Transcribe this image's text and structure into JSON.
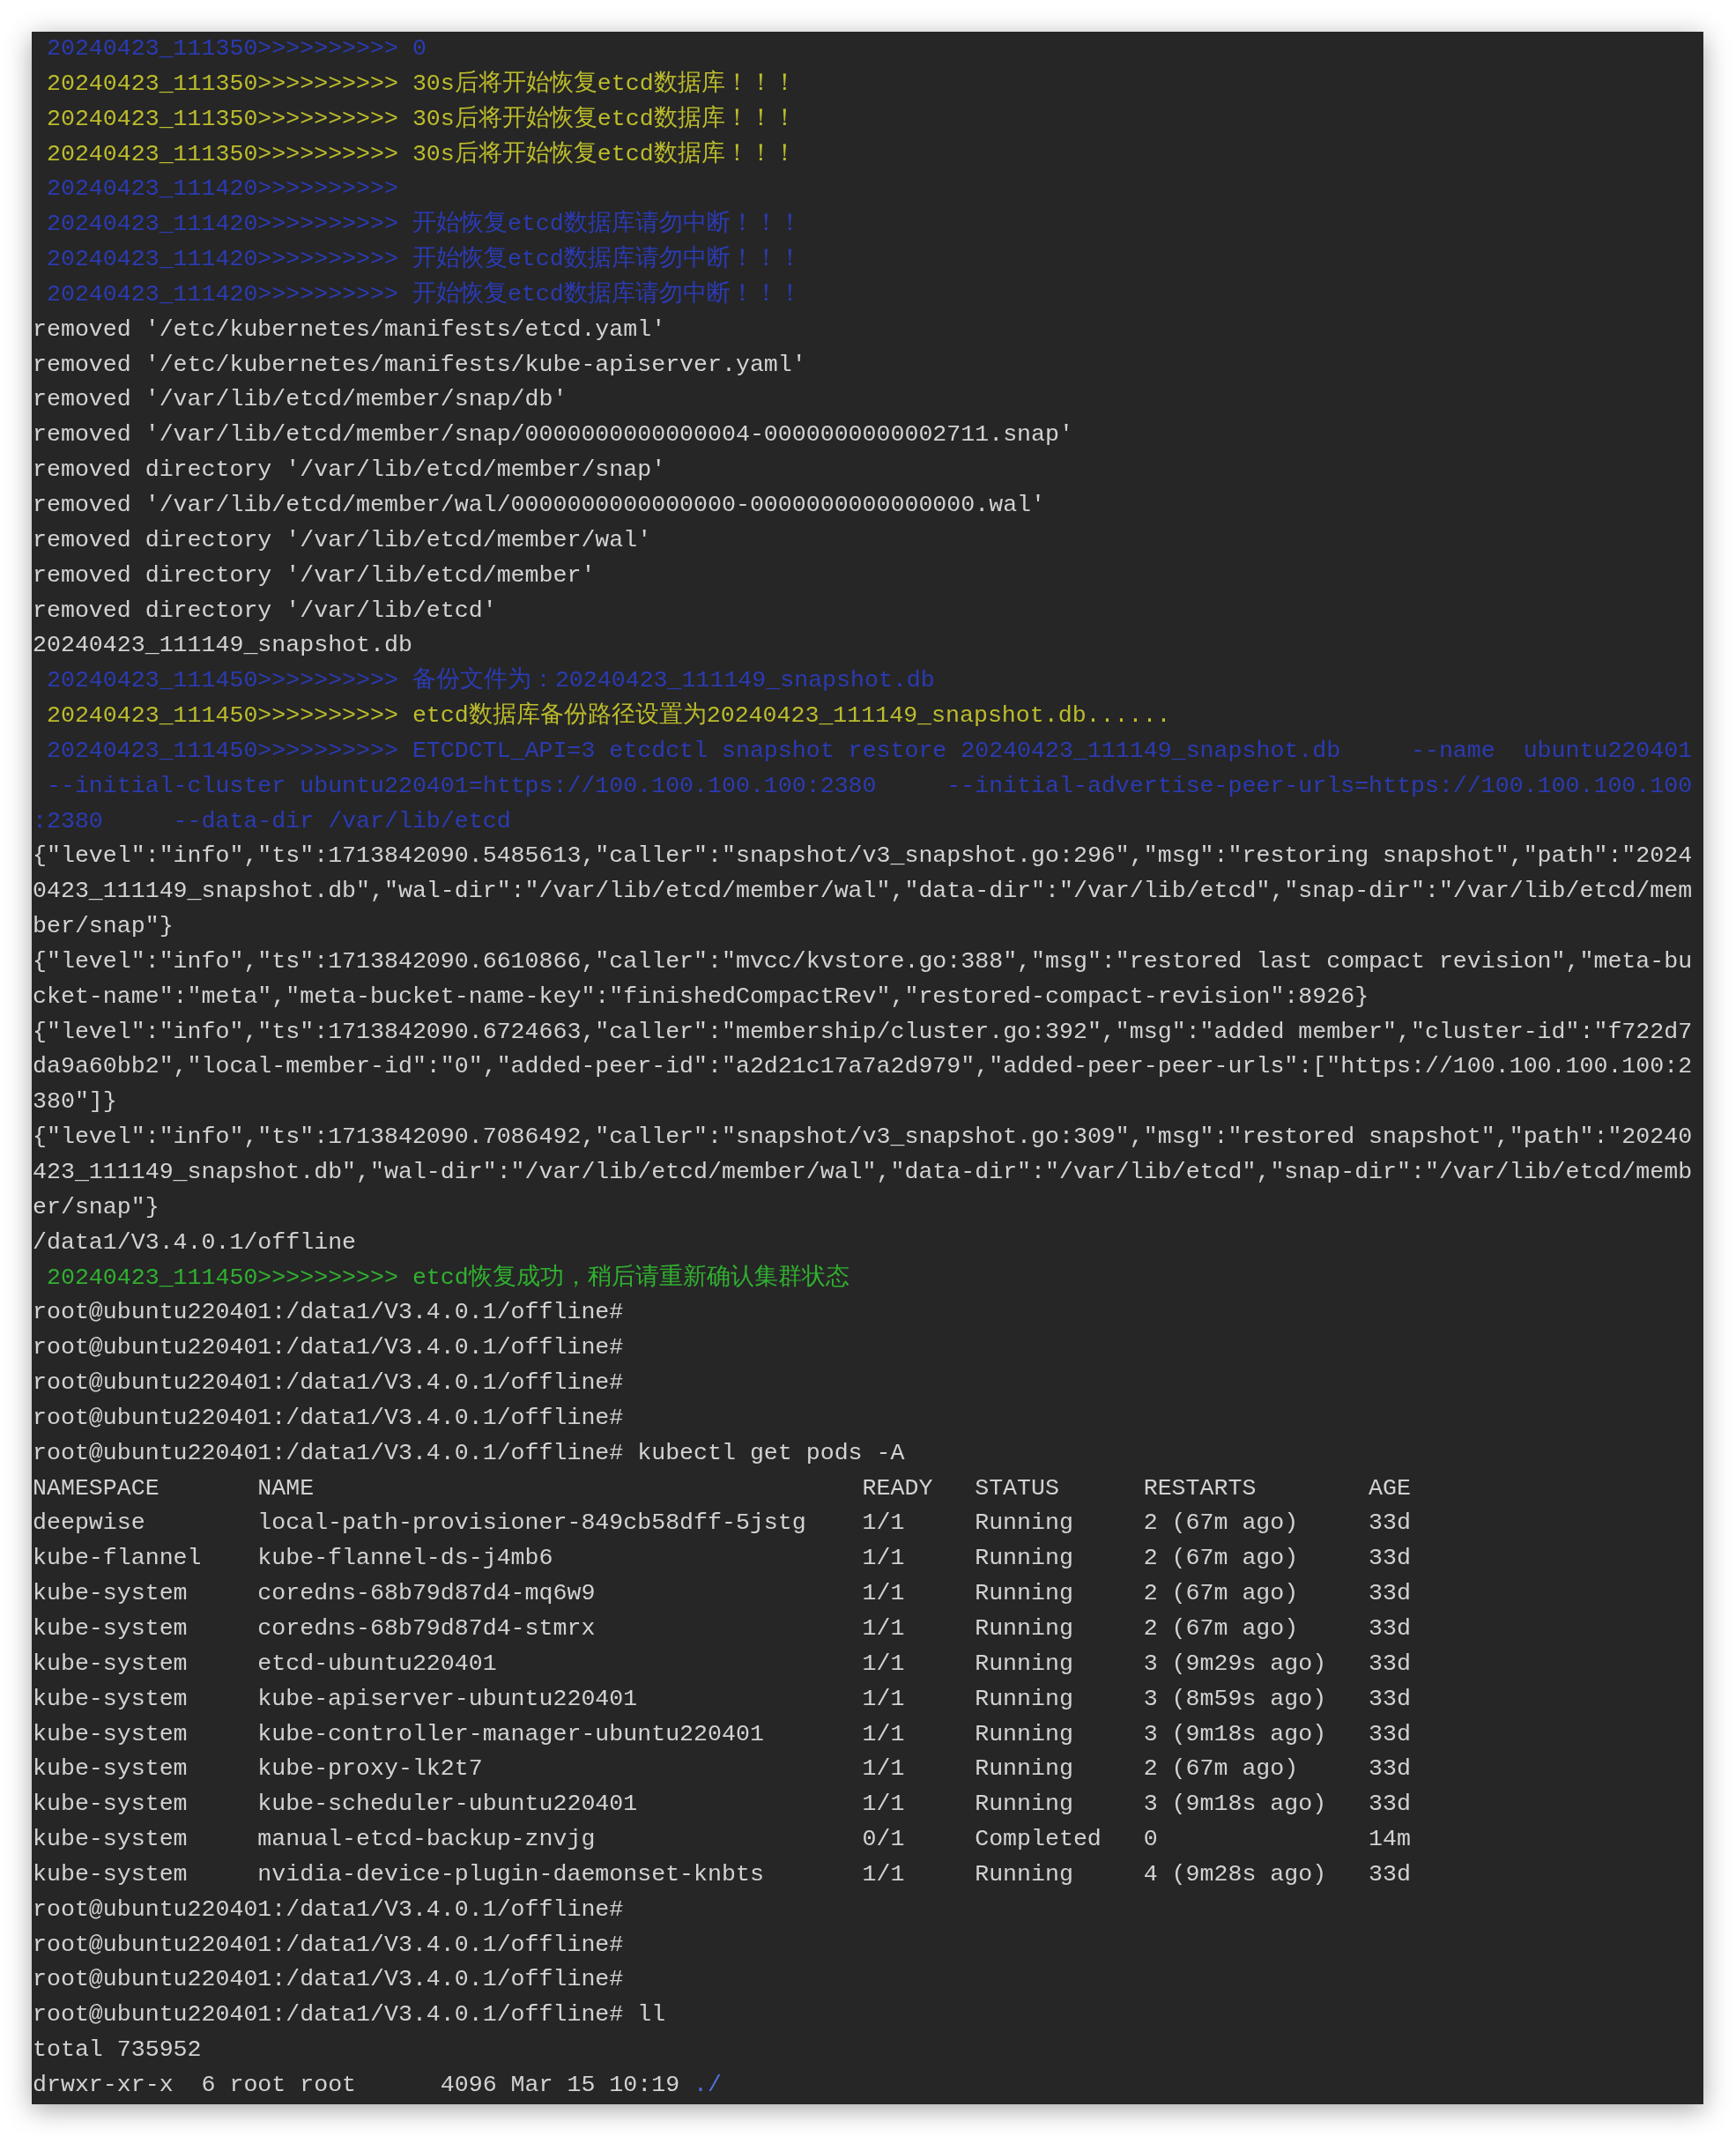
{
  "terminal": {
    "lines": [
      {
        "text": " 20240423_111350>>>>>>>>>> 0",
        "color": "#2b3bb3"
      },
      {
        "text": " 20240423_111350>>>>>>>>>> 30s后将开始恢复etcd数据库！！！",
        "color": "#bcbc2c"
      },
      {
        "text": " 20240423_111350>>>>>>>>>> 30s后将开始恢复etcd数据库！！！",
        "color": "#bcbc2c"
      },
      {
        "text": " 20240423_111350>>>>>>>>>> 30s后将开始恢复etcd数据库！！！",
        "color": "#bcbc2c"
      },
      {
        "text": " 20240423_111420>>>>>>>>>>",
        "color": "#2b3bb3"
      },
      {
        "text": " 20240423_111420>>>>>>>>>> 开始恢复etcd数据库请勿中断！！！",
        "color": "#2b3bb3"
      },
      {
        "text": " 20240423_111420>>>>>>>>>> 开始恢复etcd数据库请勿中断！！！",
        "color": "#2b3bb3"
      },
      {
        "text": " 20240423_111420>>>>>>>>>> 开始恢复etcd数据库请勿中断！！！",
        "color": "#2b3bb3"
      },
      {
        "text": "removed '/etc/kubernetes/manifests/etcd.yaml'"
      },
      {
        "text": "removed '/etc/kubernetes/manifests/kube-apiserver.yaml'"
      },
      {
        "text": "removed '/var/lib/etcd/member/snap/db'"
      },
      {
        "text": "removed '/var/lib/etcd/member/snap/0000000000000004-0000000000002711.snap'"
      },
      {
        "text": "removed directory '/var/lib/etcd/member/snap'"
      },
      {
        "text": "removed '/var/lib/etcd/member/wal/0000000000000000-0000000000000000.wal'"
      },
      {
        "text": "removed directory '/var/lib/etcd/member/wal'"
      },
      {
        "text": "removed directory '/var/lib/etcd/member'"
      },
      {
        "text": "removed directory '/var/lib/etcd'"
      },
      {
        "text": "20240423_111149_snapshot.db"
      },
      {
        "text": " 20240423_111450>>>>>>>>>> 备份文件为：20240423_111149_snapshot.db",
        "color": "#2b3bb3"
      },
      {
        "text": " 20240423_111450>>>>>>>>>> etcd数据库备份路径设置为20240423_111149_snapshot.db......",
        "color": "#bcbc2c"
      },
      {
        "text": " 20240423_111450>>>>>>>>>> ETCDCTL_API=3 etcdctl snapshot restore 20240423_111149_snapshot.db     --name  ubuntu220401",
        "color": "#2b3bb3"
      },
      {
        "text": " --initial-cluster ubuntu220401=https://100.100.100.100:2380     --initial-advertise-peer-urls=https://100.100.100.100",
        "color": "#2b3bb3"
      },
      {
        "text": ":2380     --data-dir /var/lib/etcd",
        "color": "#2b3bb3"
      },
      {
        "text": "{\"level\":\"info\",\"ts\":1713842090.5485613,\"caller\":\"snapshot/v3_snapshot.go:296\",\"msg\":\"restoring snapshot\",\"path\":\"2024"
      },
      {
        "text": "0423_111149_snapshot.db\",\"wal-dir\":\"/var/lib/etcd/member/wal\",\"data-dir\":\"/var/lib/etcd\",\"snap-dir\":\"/var/lib/etcd/mem"
      },
      {
        "text": "ber/snap\"}"
      },
      {
        "text": "{\"level\":\"info\",\"ts\":1713842090.6610866,\"caller\":\"mvcc/kvstore.go:388\",\"msg\":\"restored last compact revision\",\"meta-bu"
      },
      {
        "text": "cket-name\":\"meta\",\"meta-bucket-name-key\":\"finishedCompactRev\",\"restored-compact-revision\":8926}"
      },
      {
        "text": "{\"level\":\"info\",\"ts\":1713842090.6724663,\"caller\":\"membership/cluster.go:392\",\"msg\":\"added member\",\"cluster-id\":\"f722d7"
      },
      {
        "text": "da9a60bb2\",\"local-member-id\":\"0\",\"added-peer-id\":\"a2d21c17a7a2d979\",\"added-peer-peer-urls\":[\"https://100.100.100.100:2"
      },
      {
        "text": "380\"]}"
      },
      {
        "text": "{\"level\":\"info\",\"ts\":1713842090.7086492,\"caller\":\"snapshot/v3_snapshot.go:309\",\"msg\":\"restored snapshot\",\"path\":\"20240"
      },
      {
        "text": "423_111149_snapshot.db\",\"wal-dir\":\"/var/lib/etcd/member/wal\",\"data-dir\":\"/var/lib/etcd\",\"snap-dir\":\"/var/lib/etcd/memb"
      },
      {
        "text": "er/snap\"}"
      },
      {
        "text": "/data1/V3.4.0.1/offline"
      },
      {
        "text": " 20240423_111450>>>>>>>>>> etcd恢复成功，稍后请重新确认集群状态",
        "color": "#30b030"
      },
      {
        "text": "root@ubuntu220401:/data1/V3.4.0.1/offline#"
      },
      {
        "text": "root@ubuntu220401:/data1/V3.4.0.1/offline#"
      },
      {
        "text": "root@ubuntu220401:/data1/V3.4.0.1/offline#"
      },
      {
        "text": "root@ubuntu220401:/data1/V3.4.0.1/offline#"
      },
      {
        "text": "root@ubuntu220401:/data1/V3.4.0.1/offline# kubectl get pods -A"
      }
    ],
    "pods_table": {
      "columns": [
        "NAMESPACE",
        "NAME",
        "READY",
        "STATUS",
        "RESTARTS",
        "AGE"
      ],
      "rows": [
        [
          "deepwise",
          "local-path-provisioner-849cb58dff-5jstg",
          "1/1",
          "Running",
          "2 (67m ago)",
          "33d"
        ],
        [
          "kube-flannel",
          "kube-flannel-ds-j4mb6",
          "1/1",
          "Running",
          "2 (67m ago)",
          "33d"
        ],
        [
          "kube-system",
          "coredns-68b79d87d4-mq6w9",
          "1/1",
          "Running",
          "2 (67m ago)",
          "33d"
        ],
        [
          "kube-system",
          "coredns-68b79d87d4-stmrx",
          "1/1",
          "Running",
          "2 (67m ago)",
          "33d"
        ],
        [
          "kube-system",
          "etcd-ubuntu220401",
          "1/1",
          "Running",
          "3 (9m29s ago)",
          "33d"
        ],
        [
          "kube-system",
          "kube-apiserver-ubuntu220401",
          "1/1",
          "Running",
          "3 (8m59s ago)",
          "33d"
        ],
        [
          "kube-system",
          "kube-controller-manager-ubuntu220401",
          "1/1",
          "Running",
          "3 (9m18s ago)",
          "33d"
        ],
        [
          "kube-system",
          "kube-proxy-lk2t7",
          "1/1",
          "Running",
          "2 (67m ago)",
          "33d"
        ],
        [
          "kube-system",
          "kube-scheduler-ubuntu220401",
          "1/1",
          "Running",
          "3 (9m18s ago)",
          "33d"
        ],
        [
          "kube-system",
          "manual-etcd-backup-znvjg",
          "0/1",
          "Completed",
          "0",
          "14m"
        ],
        [
          "kube-system",
          "nvidia-device-plugin-daemonset-knbts",
          "1/1",
          "Running",
          "4 (9m28s ago)",
          "33d"
        ]
      ]
    },
    "lines_after": [
      {
        "segments": [
          {
            "text": "root@ubuntu220401:/data1/V3.4.0.1/offline#"
          }
        ]
      },
      {
        "segments": [
          {
            "text": "root@ubuntu220401:/data1/V3.4.0.1/offline#"
          }
        ]
      },
      {
        "segments": [
          {
            "text": "root@ubuntu220401:/data1/V3.4.0.1/offline#"
          }
        ]
      },
      {
        "segments": [
          {
            "text": "root@ubuntu220401:/data1/V3.4.0.1/offline# ll"
          }
        ]
      },
      {
        "segments": [
          {
            "text": "total 735952"
          }
        ]
      },
      {
        "segments": [
          {
            "text": "drwxr-xr-x  6 root root      4096 Mar 15 10:19"
          },
          {
            "text": "./",
            "color": "#4f6fd8"
          }
        ]
      }
    ]
  }
}
